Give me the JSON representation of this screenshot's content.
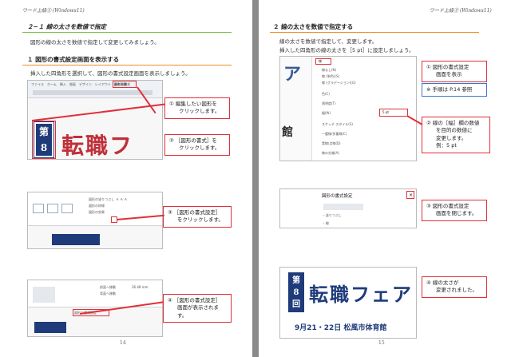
{
  "left": {
    "header": "ワード上級② (Windows11)",
    "title": "２−１ 線の太さを数値で指定",
    "intro": "図形の線の太さを数値で指定して変更してみましょう。",
    "section1": "１ 図形の書式設定画面を表示する",
    "section1_text": "挿入した四角形を選択して、図形の書式設定画面を表示しましょう。",
    "callout1": [
      "① 編集したい図形を",
      "クリックします。"
    ],
    "callout2": [
      "② ［図形の書式］を",
      "クリックします。"
    ],
    "callout3": [
      "③ ［図形の書式設定］",
      "をクリックします。"
    ],
    "callout4": [
      "④ ［図形の書式設定］",
      "画面が表示されます。"
    ],
    "ribbon_tab": "図形の書式",
    "page_number": "14",
    "poster_badge": [
      "第",
      "8"
    ],
    "poster_title": "転職フ"
  },
  "right": {
    "header": "ワード上級② (Windows11)",
    "section2": "２ 線の太さを数値で指定する",
    "text1": "線の太さを数値で指定して、変更します。",
    "text2": "挿入した四角形の線の太さを［5 pt］に設定しましょう。",
    "callout1": [
      "① 図形の書式設定",
      "画面を表示"
    ],
    "note": "※ 手順は P.14 参照",
    "callout2": [
      "② 線の［幅］欄の数値",
      "を目的の数値に",
      "変更します。",
      "例：5 pt"
    ],
    "callout3": [
      "③ 図形の書式設定",
      "画面を閉じます。"
    ],
    "callout4": [
      "④ 線の太さが",
      "変更されました。"
    ],
    "pane_title": "図形の書式設定",
    "pane_width_value": "5 pt",
    "pane_items": [
      "線",
      "線なし(N)",
      "線 (単色)(S)",
      "線 (グラデーション)(G)",
      "色(C)",
      "透明度(T)",
      "幅(W)",
      "スケッチ スタイル(S)",
      "一重線/多重線(C)",
      "実線/点線(D)",
      "線の先端(A)"
    ],
    "poster_badge": [
      "第",
      "8",
      "回"
    ],
    "poster_title": "転職フェア",
    "poster_date": "9月21・22日 松風市体育館",
    "page_number": "15"
  }
}
